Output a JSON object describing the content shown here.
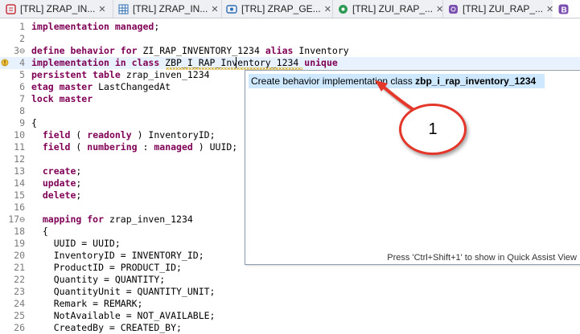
{
  "tabs": [
    {
      "label": "[TRL] ZRAP_IN...",
      "icon": "ddl-source-icon",
      "icon_color": "#c8323c",
      "active": false
    },
    {
      "label": "[TRL] ZRAP_IN...",
      "icon": "table-icon",
      "icon_color": "#2f6fb5",
      "active": false
    },
    {
      "label": "[TRL] ZRAP_GE...",
      "icon": "service-icon",
      "icon_color": "#2f6fb5",
      "active": false
    },
    {
      "label": "[TRL] ZUI_RAP_...",
      "icon": "service-definition-icon",
      "icon_color": "#2e9b55",
      "active": false
    },
    {
      "label": "[TRL] ZUI_RAP_...",
      "icon": "behavior-definition-icon",
      "icon_color": "#7a4fb0",
      "active": false
    },
    {
      "label": "",
      "icon": "behavior-icon",
      "icon_color": "#7a4fb0",
      "active": true
    }
  ],
  "code": [
    {
      "n": "1",
      "fold": false,
      "html": "<span class='kw'>implementation managed</span>;"
    },
    {
      "n": "2",
      "fold": false,
      "html": ""
    },
    {
      "n": "3",
      "fold": true,
      "html": "<span class='kw'>define behavior for</span> ZI_RAP_INVENTORY_1234 <span class='kw'>alias</span> Inventory"
    },
    {
      "n": "4",
      "fold": false,
      "current": true,
      "warn": true,
      "html": "<span class='kw'>implementation in class</span> ZBP_I_RAP_Inventory_1234 <span class='kw'>unique</span>"
    },
    {
      "n": "5",
      "fold": false,
      "html": "<span class='kw'>persistent table</span> zrap_inven_1234"
    },
    {
      "n": "6",
      "fold": false,
      "html": "<span class='kw'>etag master</span> LastChangedAt"
    },
    {
      "n": "7",
      "fold": false,
      "html": "<span class='kw'>lock master</span>"
    },
    {
      "n": "8",
      "fold": false,
      "html": ""
    },
    {
      "n": "9",
      "fold": false,
      "html": "{"
    },
    {
      "n": "10",
      "fold": false,
      "html": "  <span class='kw'>field</span> ( <span class='kw'>readonly</span> ) InventoryID;"
    },
    {
      "n": "11",
      "fold": false,
      "html": "  <span class='kw'>field</span> ( <span class='kw'>numbering</span> : <span class='kw'>managed</span> ) UUID;"
    },
    {
      "n": "12",
      "fold": false,
      "html": ""
    },
    {
      "n": "13",
      "fold": false,
      "html": "  <span class='kw'>create</span>;"
    },
    {
      "n": "14",
      "fold": false,
      "html": "  <span class='kw'>update</span>;"
    },
    {
      "n": "15",
      "fold": false,
      "html": "  <span class='kw'>delete</span>;"
    },
    {
      "n": "16",
      "fold": false,
      "html": ""
    },
    {
      "n": "17",
      "fold": true,
      "html": "  <span class='kw'>mapping for</span> zrap_inven_1234"
    },
    {
      "n": "18",
      "fold": false,
      "html": "  {"
    },
    {
      "n": "19",
      "fold": false,
      "html": "    UUID = UUID;"
    },
    {
      "n": "20",
      "fold": false,
      "html": "    InventoryID = INVENTORY_ID;"
    },
    {
      "n": "21",
      "fold": false,
      "html": "    ProductID = PRODUCT_ID;"
    },
    {
      "n": "22",
      "fold": false,
      "html": "    Quantity = QUANTITY;"
    },
    {
      "n": "23",
      "fold": false,
      "html": "    QuantityUnit = QUANTITY_UNIT;"
    },
    {
      "n": "24",
      "fold": false,
      "html": "    Remark = REMARK;"
    },
    {
      "n": "25",
      "fold": false,
      "html": "    NotAvailable = NOT_AVAILABLE;"
    },
    {
      "n": "26",
      "fold": false,
      "html": "    CreatedBy = CREATED_BY;"
    }
  ],
  "popup": {
    "proposal_prefix": "Create behavior implementation class ",
    "proposal_class": "zbp_i_rap_inventory_1234",
    "footer": "Press 'Ctrl+Shift+1' to show in Quick Assist View"
  },
  "callout": {
    "label": "1",
    "color": "#e4372a"
  }
}
